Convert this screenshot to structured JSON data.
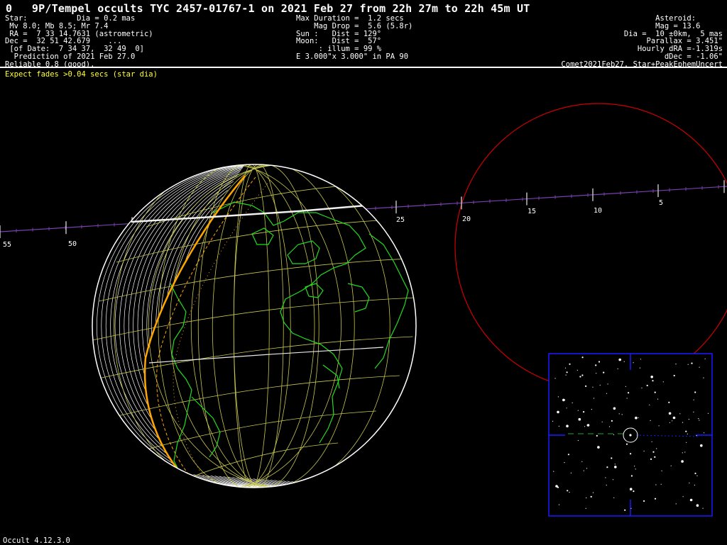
{
  "title": "0   9P/Tempel occults TYC 2457-01767-1 on 2021 Feb 27 from 22h 27m to 22h 45m UT",
  "header_left": [
    "Star:           Dia = 0.2 mas",
    " Mv 8.0; Mb 8.5; Mr 7.4",
    " RA =  7 33 14.7631 (astrometric)",
    "Dec =  32 51 42.679    ...",
    " [of Date:  7 34 37,  32 49  0]",
    "  Prediction of 2021 Feb 27.0",
    "Reliable 0.8 (good),"
  ],
  "header_mid": [
    "Max Duration =  1.2 secs",
    "    Mag Drop =  5.6 (5.8r)",
    "Sun :   Dist = 129°",
    "Moon:   Dist =  57°",
    "     : illum = 99 %",
    "E 3.000\"x 3.000\" in PA 90"
  ],
  "header_right": [
    "Asteroid:      ",
    "Mag = 13.6     ",
    "Dia =  10 ±0km,  5 mas",
    "Parallax = 3.451\"",
    "Hourly dRA =-1.319s",
    "dDec = -1.06\"",
    "Comet2021Feb27, Star+PeakEphemUncert"
  ],
  "fades_note": "Expect fades >0.04 secs (star dia)",
  "footer_version": "Occult 4.12.3.0",
  "path_tick_labels": [
    "55",
    "50",
    "25",
    "20",
    "15",
    "10",
    "5"
  ],
  "colors": {
    "background": "#000000",
    "text": "#ffffff",
    "note": "#ffff33",
    "coastline": "#22dd22",
    "graticule": "#c8c850",
    "shadow_edge": "#ffa500",
    "moon_circle": "#cc0000",
    "path_line": "#7a3fb0",
    "inset_frame": "#1a1aff"
  },
  "icons": {
    "earth": "globe-icon",
    "moon": "moon-circle-icon",
    "star_chart": "star-field-icon"
  }
}
